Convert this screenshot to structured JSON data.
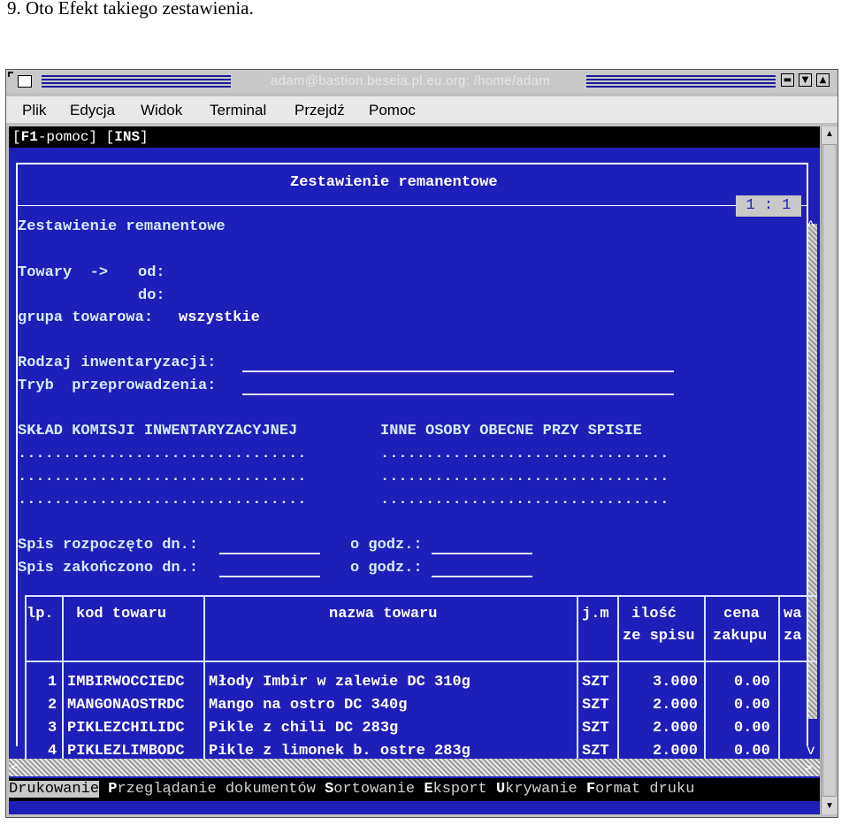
{
  "caption": "9.  Oto Efekt takiego zestawienia.",
  "window": {
    "title": "adam@bastion.beseia.pl.eu.org: /home/adam",
    "buttons": [
      "▬",
      "▼",
      "▲"
    ]
  },
  "menu": [
    "Plik",
    "Edycja",
    "Widok",
    "Terminal",
    "Przejdź",
    "Pomoc"
  ],
  "terminal": {
    "topline_f1": "F1",
    "topline_pomoc": "-pomoc]",
    "topline_ins": "INS",
    "frame_title": "Zestawienie remanentowe",
    "page_indicator": "1 : 1",
    "heading": "Zestawienie remanentowe",
    "towary_label": "Towary  ->",
    "od_label": "od:",
    "do_label": "do:",
    "grupa_label": "grupa towarowa:",
    "grupa_value": "wszystkie",
    "rodzaj_label": "Rodzaj inwentaryzacji:",
    "tryb_label": "Tryb  przeprowadzenia:",
    "komisja_label": "SKŁAD KOMISJI INWENTARYZACYJNEJ",
    "inne_label": "INNE OSOBY OBECNE PRZY SPISIE",
    "dots_left": "................................",
    "dots_right": "................................",
    "spis_start_label": "Spis rozpoczęto dn.:",
    "spis_end_label": "Spis zakończono dn.:",
    "godz_label": "o godz.:",
    "table": {
      "headers": {
        "lp": "lp.",
        "kod": "kod towaru",
        "nazwa": "nazwa towaru",
        "jm": "j.m",
        "ilosc_1": "ilość",
        "ilosc_2": "ze spisu",
        "cena_1": "cena",
        "cena_2": "zakupu",
        "wa_1": "wa",
        "wa_2": "za"
      },
      "rows": [
        {
          "lp": "1",
          "kod": "IMBIRWOCCIEDC",
          "nazwa": "Młody Imbir w zalewie DC 310g",
          "jm": "SZT",
          "ilosc": "3.000",
          "cena": "0.00"
        },
        {
          "lp": "2",
          "kod": "MANGONAOSTRDC",
          "nazwa": "Mango na ostro DC 340g",
          "jm": "SZT",
          "ilosc": "2.000",
          "cena": "0.00"
        },
        {
          "lp": "3",
          "kod": "PIKLEZCHILIDC",
          "nazwa": "Pikle z chili DC 283g",
          "jm": "SZT",
          "ilosc": "2.000",
          "cena": "0.00"
        },
        {
          "lp": "4",
          "kod": "PIKLEZLIMBODC",
          "nazwa": "Pikle z limonek b. ostre 283g",
          "jm": "SZT",
          "ilosc": "2.000",
          "cena": "0.00"
        }
      ]
    },
    "statusbar": {
      "drukowanie": "Drukowanie",
      "p": "P",
      "przegladanie": "rzeglądanie dokumentów ",
      "s": "S",
      "sortowanie": "ortowanie ",
      "e": "E",
      "eksport": "ksport ",
      "u": "U",
      "ukrywanie": "krywanie ",
      "f": "F",
      "format": "ormat druku"
    }
  }
}
